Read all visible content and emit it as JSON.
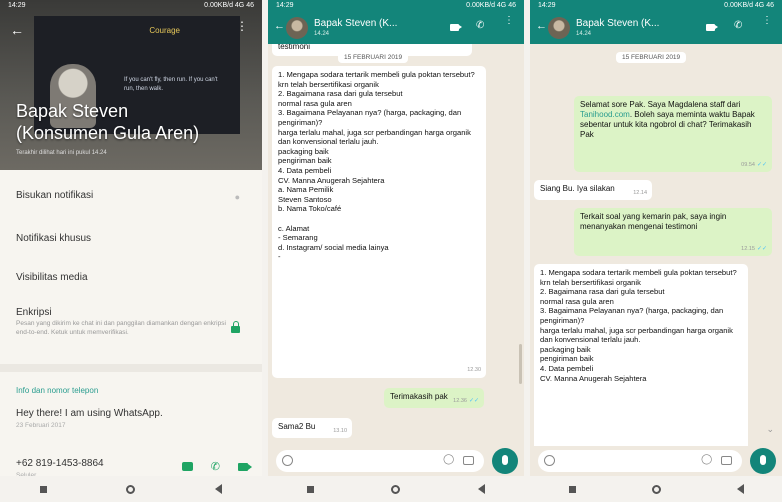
{
  "status_bar": {
    "left": "14:29",
    "right": "0.00KB/d 4G 46"
  },
  "profile": {
    "name_line1": "Bapak Steven",
    "name_line2": "(Konsumen Gula Aren)",
    "last_seen": "Terakhir dilihat hari ini pukul 14.24",
    "slide_title": "Courage",
    "slide_quote": "If you can't fly, then run. If you can't run, then walk.",
    "settings": [
      "Bisukan notifikasi",
      "Notifikasi khusus",
      "Visibilitas media",
      "Enkripsi"
    ],
    "encryption_desc": "Pesan yang dikirim ke chat ini dan panggilan diamankan dengan enkripsi end-to-end. Ketuk untuk memverifikasi.",
    "info_title": "Info dan nomor telepon",
    "about": "Hey there! I am using WhatsApp.",
    "about_date": "23 Februari 2017",
    "phone_number": "+62 819-1453-8864",
    "phone_label": "Seluler"
  },
  "chat": {
    "contact": "Bapak Steven (K...",
    "subtitle": "14.24",
    "date": "15 FEBRUARI 2019",
    "top_partial": "testimoni",
    "greeting": "Selamat sore Pak. Saya Magdalena staff dari Tanihood.com. Boleh saya meminta waktu Bapak sebentar untuk kita ngobrol di chat? Terimakasih Pak",
    "greeting_link": "Tanihood.com",
    "greeting_time": "09.54",
    "reply1": "Siang Bu. Iya silakan",
    "reply1_time": "12.14",
    "ask": "Terkait soal yang kemarin pak, saya ingin menanyakan mengenai testimoni",
    "ask_time": "12.15",
    "questionnaire": "1. Mengapa sodara tertarik membeli gula poktan tersebut?\n      krn telah bersertifikasi organik\n2. Bagaimana rasa dari gula tersebut\n      normal rasa gula aren\n3. Bagaimana Pelayanan nya? (harga, packaging, dan pengiriman)?\n      harga terlalu mahal, juga scr perbandingan harga organik dan konvensional terlalu jauh.\n      packaging baik\n      pengiriman baik\n4. Data pembeli\n      CV. Manna Anugerah Sejahtera\na. Nama Pemilik\n      Steven Santoso\nb. Nama Toko/café\n\nc. Alamat\n      - Semarang\nd. Instagram/ social media lainya\n      -",
    "questionnaire_time": "12.30",
    "thanks": "Terimakasih pak",
    "thanks_time": "12.36",
    "last_in": "Sama2 Bu",
    "last_in_time": "13.10",
    "q_partial": "1. Mengapa sodara tertarik membeli gula poktan tersebut?\n      krn telah bersertifikasi organik\n2. Bagaimana rasa dari gula tersebut\n      normal rasa gula aren\n3. Bagaimana Pelayanan nya? (harga, packaging, dan pengiriman)?\n      harga terlalu mahal, juga scr perbandingan harga organik dan konvensional terlalu jauh.\n      packaging baik\n      pengiriman baik\n4. Data pembeli\n      CV. Manna Anugerah Sejahtera"
  },
  "colors": {
    "header": "#13857a",
    "outgoing": "#dcf3c6",
    "accent": "#1fa463"
  },
  "icons": [
    "back-arrow-icon",
    "kebab-menu-icon",
    "video-call-icon",
    "voice-call-icon",
    "message-icon",
    "lock-icon",
    "emoji-icon",
    "attach-icon",
    "camera-icon",
    "mic-icon"
  ]
}
